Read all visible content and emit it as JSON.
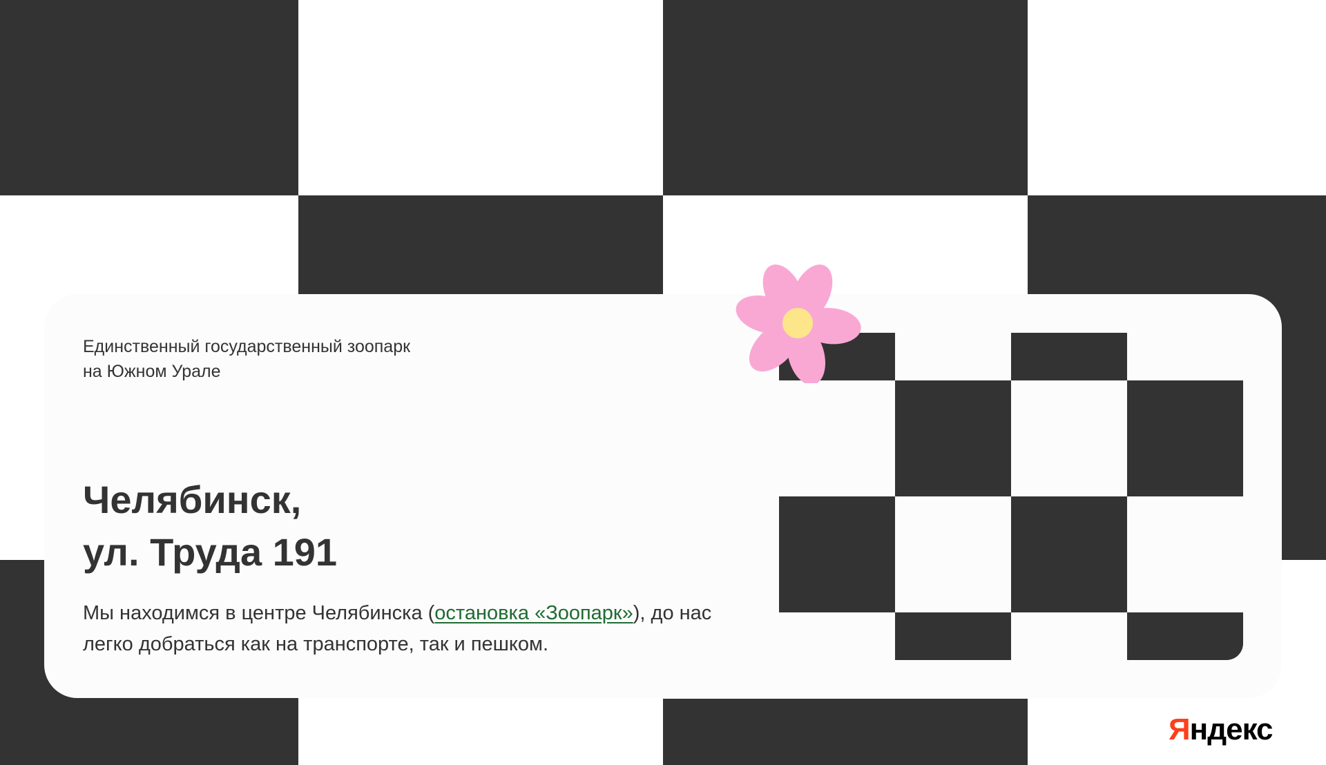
{
  "card": {
    "subtitle": "Единственный государственный зоопарк на Южном Урале",
    "address_line_1": "Челябинск,",
    "address_line_2": "ул. Труда 191",
    "description_before": "Мы находимся в центре Челябинска (",
    "description_link": "остановка «Зоопарк»",
    "description_after": "), до нас легко добраться как на транспорте, так и пешком."
  },
  "logo": {
    "first_letter": "Я",
    "rest": "ндекс"
  },
  "colors": {
    "dark": "#333333",
    "background": "#ffffff",
    "card": "#fcfcfc",
    "link": "#1f6b32",
    "flower_petal": "#f9a8d4",
    "flower_center": "#fde68a",
    "logo_accent": "#fc3f1d"
  },
  "icons": {
    "flower": "flower-icon"
  }
}
